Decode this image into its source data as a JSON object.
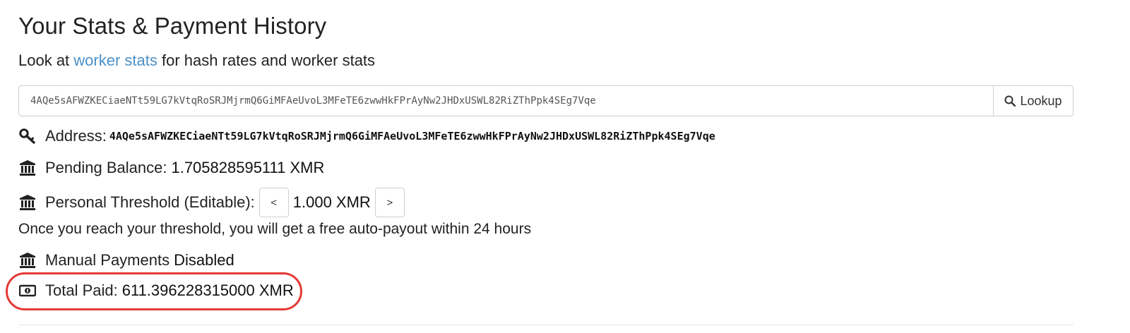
{
  "header": {
    "title": "Your Stats & Payment History",
    "subtitle_prefix": "Look at",
    "subtitle_link": "worker stats",
    "subtitle_suffix": "for hash rates and worker stats"
  },
  "lookup": {
    "value": "4AQe5sAFWZKECiaeNTt59LG7kVtqRoSRJMjrmQ6GiMFAeUvoL3MFeTE6zwwHkFPrAyNw2JHDxUSWL82RiZThPpk4SEg7Vqe",
    "button_label": "Lookup"
  },
  "stats": {
    "address_label": "Address:",
    "address_value": "4AQe5sAFWZKECiaeNTt59LG7kVtqRoSRJMjrmQ6GiMFAeUvoL3MFeTE6zwwHkFPrAyNw2JHDxUSWL82RiZThPpk4SEg7Vqe",
    "pending_label": "Pending Balance:",
    "pending_value": "1.705828595111 XMR",
    "threshold_label": "Personal Threshold (Editable):",
    "threshold_decrease": "<",
    "threshold_value": "1.000 XMR",
    "threshold_increase": ">",
    "threshold_note": "Once you reach your threshold, you will get a free auto-payout within 24 hours",
    "manual_label": "Manual Payments",
    "manual_value": "Disabled",
    "total_label": "Total Paid:",
    "total_value": "611.396228315000 XMR"
  },
  "icons": {
    "address": "key-icon",
    "pending": "bank-icon",
    "threshold": "bank-icon",
    "manual": "bank-icon",
    "total": "money-bill-icon",
    "lookup": "search-icon"
  },
  "colors": {
    "link": "#4a90c8",
    "highlight": "#e53935"
  }
}
